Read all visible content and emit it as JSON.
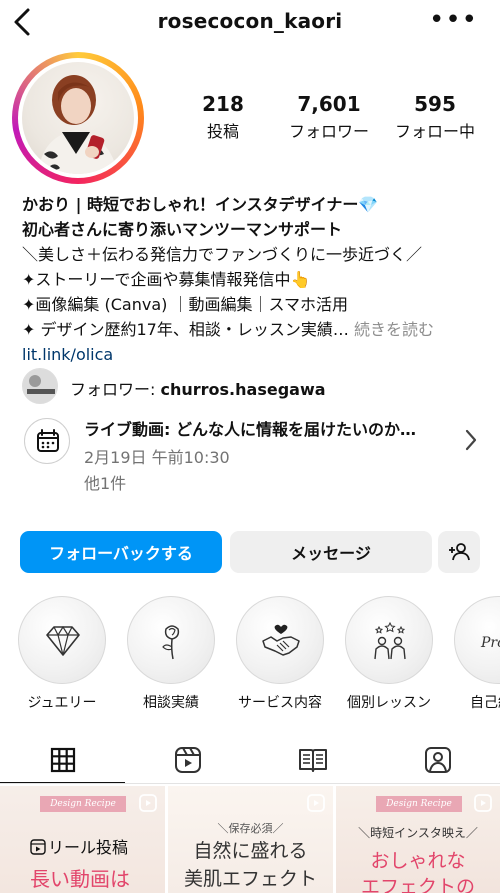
{
  "header": {
    "username": "rosecocon_kaori",
    "more_label": "•••"
  },
  "stats": [
    {
      "value": "218",
      "label": "投稿"
    },
    {
      "value": "7,601",
      "label": "フォロワー"
    },
    {
      "value": "595",
      "label": "フォロー中"
    }
  ],
  "bio": {
    "line1": "かおり | 時短でおしゃれ！インスタデザイナー💎",
    "line2": "初心者さんに寄り添いマンツーマンサポート",
    "line3": "＼美しさ＋伝わる発信力でファンづくりに一歩近づく／",
    "line4": "✦ストーリーで企画や募集情報発信中👆",
    "line5": "✦画像編集 (Canva) ｜動画編集｜スマホ活用",
    "line6": "✦ デザイン歴約17年、相談・レッスン実績…",
    "more": "続きを読む",
    "link": "lit.link/olica"
  },
  "followed_by": {
    "prefix": "フォロワー: ",
    "name": "churros.hasegawa"
  },
  "event": {
    "title": "ライブ動画: どんな人に情報を届けたいのか…",
    "date": "2月19日 午前10:30",
    "count": "他1件"
  },
  "buttons": {
    "follow_back": "フォローバックする",
    "message": "メッセージ"
  },
  "highlights": [
    {
      "label": "ジュエリー",
      "icon": "diamond-icon"
    },
    {
      "label": "相談実績",
      "icon": "rose-icon"
    },
    {
      "label": "サービス内容",
      "icon": "handshake-icon"
    },
    {
      "label": "個別レッスン",
      "icon": "people-stars-icon"
    },
    {
      "label": "自己紹介",
      "icon": "profile-text-icon"
    }
  ],
  "tabs": [
    "grid-icon",
    "reels-icon",
    "guide-icon",
    "tagged-icon"
  ],
  "posts": [
    {
      "tag": "Design Recipe",
      "line1": "リール投稿",
      "line2": "長い動画は"
    },
    {
      "line0": "＼保存必須／",
      "line1": "自然に盛れる",
      "line2": "美肌エフェクト"
    },
    {
      "tag": "Design Recipe",
      "line0": "＼時短インスタ映え／",
      "line1": "おしゃれな",
      "line2": "エフェクトの"
    }
  ]
}
